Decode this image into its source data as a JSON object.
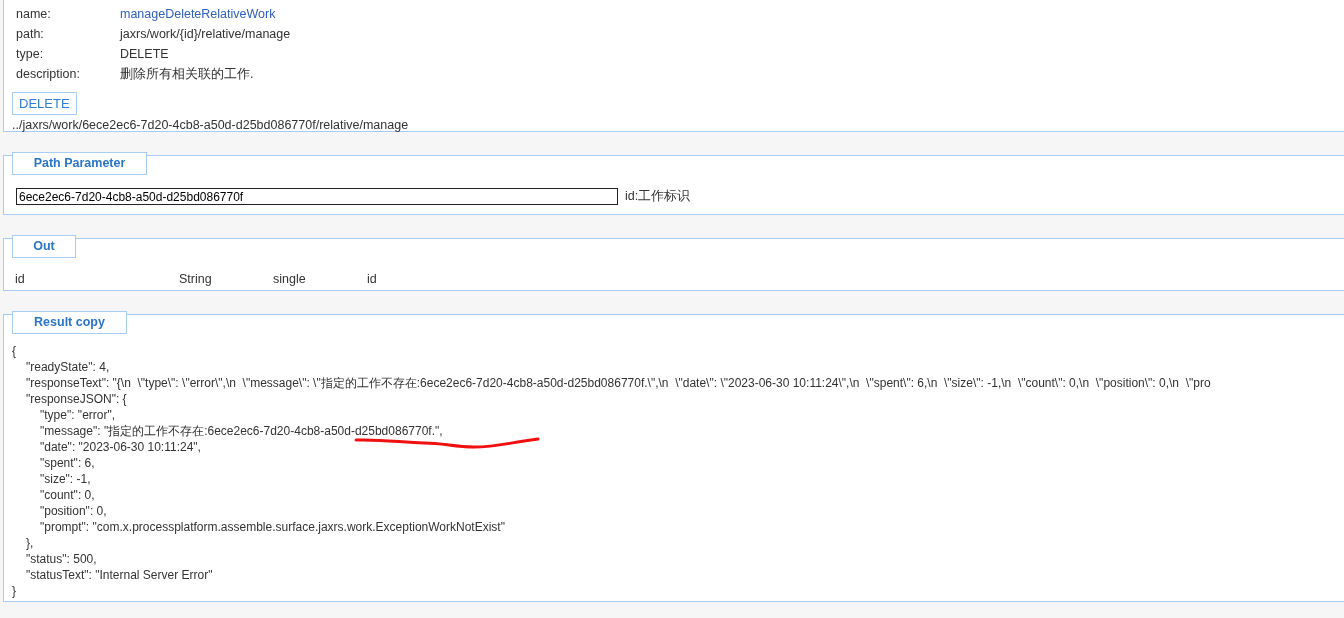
{
  "info": [
    {
      "label": "name:",
      "value": "manageDeleteRelativeWork",
      "kind": "link"
    },
    {
      "label": "path:",
      "value": "jaxrs/work/{id}/relative/manage",
      "kind": "text"
    },
    {
      "label": "type:",
      "value": "DELETE",
      "kind": "text"
    },
    {
      "label": "description:",
      "value": "删除所有相关联的工作.",
      "kind": "text"
    }
  ],
  "method_button": "DELETE",
  "request_url": "../jaxrs/work/6ece2ec6-7d20-4cb8-a50d-d25bd086770f/relative/manage",
  "path_parameter": {
    "legend": "Path Parameter",
    "value": "6ece2ec6-7d20-4cb8-a50d-d25bd086770f",
    "hint": "id:工作标识"
  },
  "out": {
    "legend": "Out",
    "cells": [
      "id",
      "String",
      "single",
      "id"
    ]
  },
  "result": {
    "legend": "Result copy",
    "lines": [
      {
        "text": "{",
        "children": [
          {
            "text": "\"readyState\": 4,"
          },
          {
            "text": "\"responseText\": \"{\\n  \\\"type\\\": \\\"error\\\",\\n  \\\"message\\\": \\\"指定的工作不存在:6ece2ec6-7d20-4cb8-a50d-d25bd086770f.\\\",\\n  \\\"date\\\": \\\"2023-06-30 10:11:24\\\",\\n  \\\"spent\\\": 6,\\n  \\\"size\\\": -1,\\n  \\\"count\\\": 0,\\n  \\\"position\\\": 0,\\n  \\\"pro"
          },
          {
            "text": "\"responseJSON\": {",
            "children": [
              {
                "text": "\"type\": \"error\","
              },
              {
                "text": "\"message\": \"指定的工作不存在:6ece2ec6-7d20-4cb8-a50d-d25bd086770f.\",",
                "underlined": true
              },
              {
                "text": "\"date\": \"2023-06-30 10:11:24\","
              },
              {
                "text": "\"spent\": 6,"
              },
              {
                "text": "\"size\": -1,"
              },
              {
                "text": "\"count\": 0,"
              },
              {
                "text": "\"position\": 0,"
              },
              {
                "text": "\"prompt\": \"com.x.processplatform.assemble.surface.jaxrs.work.ExceptionWorkNotExist\""
              }
            ]
          },
          {
            "text": "},"
          },
          {
            "text": "\"status\": 500,"
          },
          {
            "text": "\"statusText\": \"Internal Server Error\""
          }
        ]
      },
      {
        "text": "}"
      }
    ]
  }
}
